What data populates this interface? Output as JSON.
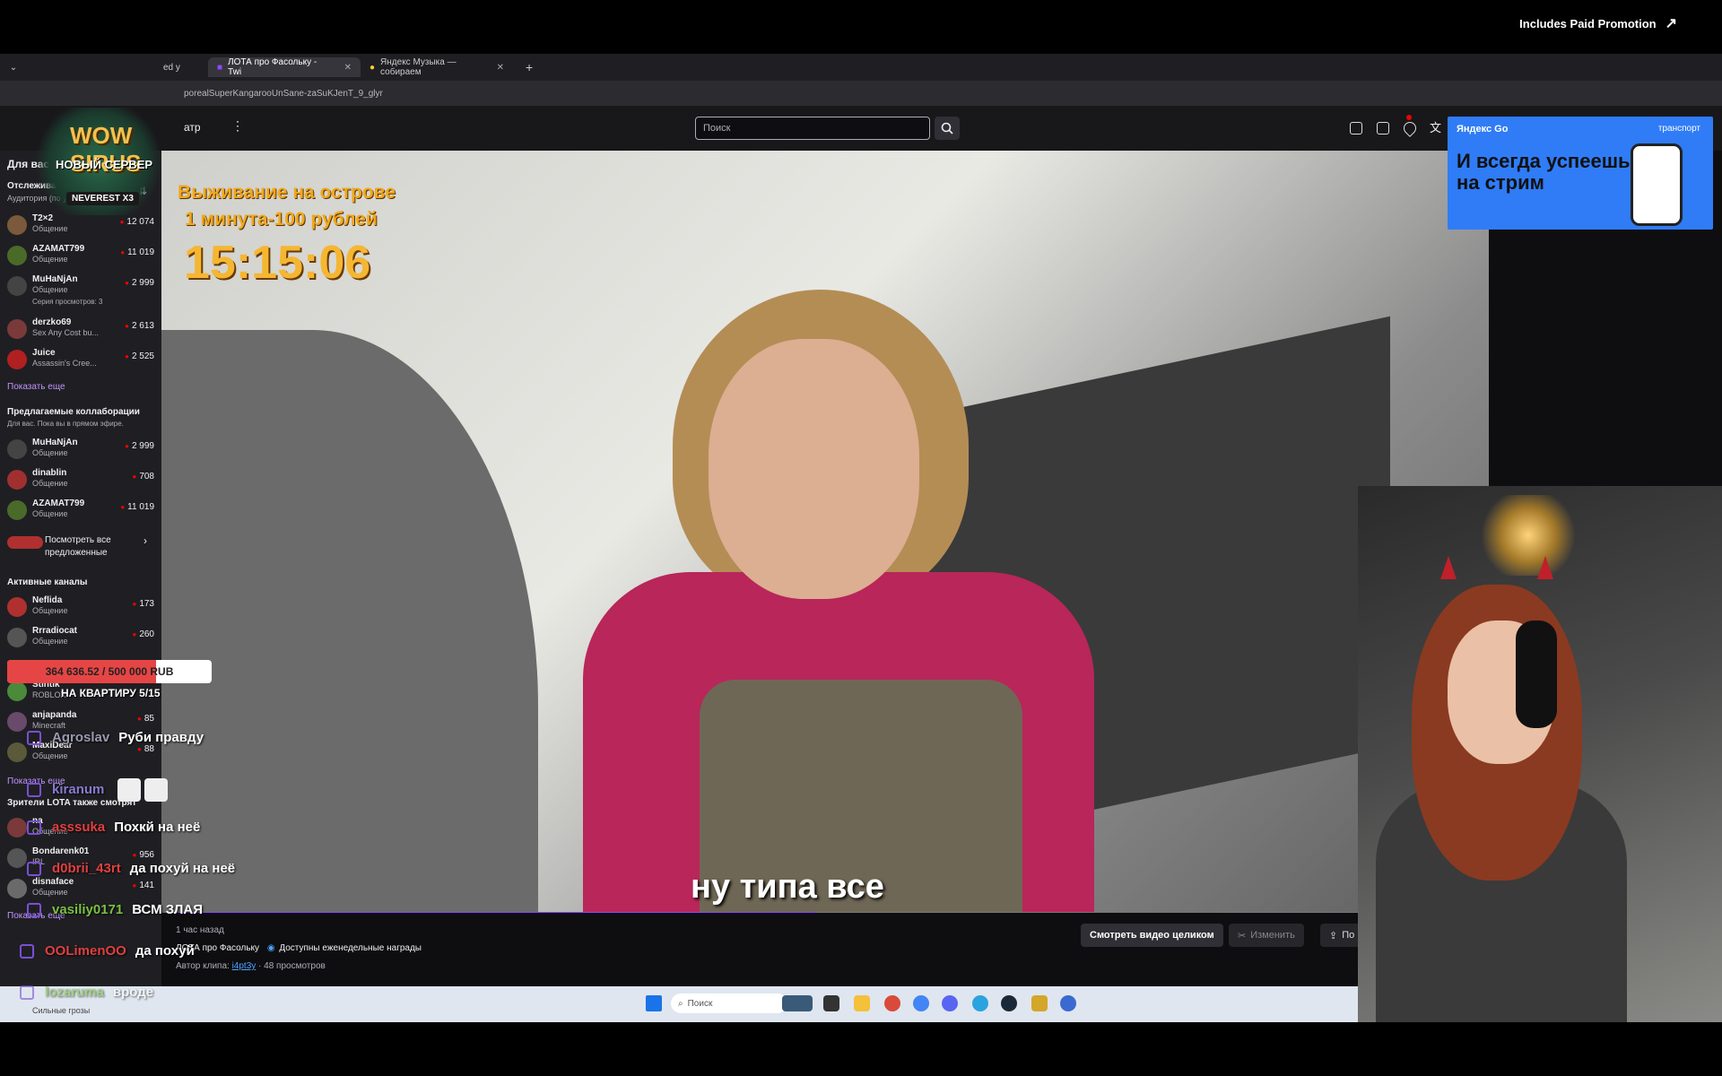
{
  "player": {
    "paid_promo": "Includes Paid Promotion"
  },
  "browser": {
    "tabs": [
      {
        "label": "ed y"
      },
      {
        "label": "ЛОТА про Фасольку - Twi"
      },
      {
        "label": "Яндекс Музыка — собираем"
      }
    ],
    "new_tab": "+",
    "url": "porealSuperKangarooUnSane-zaSuKJenT_9_glyr"
  },
  "twitch": {
    "nav_label": "атр",
    "search_placeholder": "Поиск"
  },
  "sidebar": {
    "for_you": "Для вас",
    "followed_header": "Отслеживаемые каналы",
    "followed_sub": "Аудитория (по убыв.)",
    "followed": [
      {
        "name": "T2×2",
        "game": "Общение",
        "viewers": "12 074",
        "color": "#7a5a3a"
      },
      {
        "name": "AZAMAT799",
        "game": "Общение",
        "viewers": "11 019",
        "color": "#4a6a2a"
      },
      {
        "name": "MuHaNjAn",
        "game": "Общение",
        "viewers": "2 999",
        "color": "#444"
      },
      {
        "name": "derzko69",
        "game": "Sex Any Cost bu...",
        "viewers": "2 613",
        "color": "#7a3a3a"
      },
      {
        "name": "Juice",
        "game": "Assassin's Cree...",
        "viewers": "2 525",
        "color": "#b02020"
      }
    ],
    "followed_extra": "Серия просмотров: 3",
    "show_more_1": "Показать еще",
    "collab_header": "Предлагаемые коллаборации",
    "collab_sub": "Для вас. Пока вы в прямом эфире.",
    "collab": [
      {
        "name": "MuHaNjAn",
        "game": "Общение",
        "viewers": "2 999",
        "color": "#444"
      },
      {
        "name": "dinablin",
        "game": "Общение",
        "viewers": "708",
        "color": "#a03030"
      },
      {
        "name": "AZAMAT799",
        "game": "Общение",
        "viewers": "11 019",
        "color": "#4a6a2a"
      }
    ],
    "see_all": "Посмотреть все предложенные",
    "active_header": "Активные каналы",
    "active": [
      {
        "name": "Neflida",
        "game": "Общение",
        "viewers": "173",
        "color": "#b03030"
      },
      {
        "name": "Rrradiocat",
        "game": "Общение",
        "viewers": "260",
        "color": "#555"
      },
      {
        "name": "Stintik",
        "game": "ROBLOX",
        "viewers": "",
        "color": "#4a8a3a"
      },
      {
        "name": "anjapanda",
        "game": "Minecraft",
        "viewers": "85",
        "color": "#6a4a6a"
      },
      {
        "name": "MaxiDear",
        "game": "Общение",
        "viewers": "88",
        "color": "#5a5a3a"
      }
    ],
    "show_more_2": "Показать еще",
    "also_watch": "Зрители LOTA также смотрят",
    "also": [
      {
        "name": "na",
        "game": "Общение",
        "viewers": "",
        "color": "#7a3a3a"
      },
      {
        "name": "Bondarenk01",
        "game": "IRL",
        "viewers": "956",
        "color": "#555"
      },
      {
        "name": "disnaface",
        "game": "Общение",
        "viewers": "141",
        "color": "#6a6a6a"
      }
    ],
    "show_more_3": "Показать еще"
  },
  "overlay": {
    "title_line1": "Выживание на острове",
    "title_line2": "1 минута-100 рублей",
    "timer": "15:15:06",
    "subtitle": "ну типа все"
  },
  "donation": {
    "text": "364 636.52 / 500 000 RUB",
    "label": "НА КВАРТИРУ 5/15",
    "progress": 0.729
  },
  "clip_info": {
    "time_ago": "1 час назад",
    "channel": "ЛОТА про Фасольку",
    "rewards": "Доступны еженедельные награды",
    "author_prefix": "Автор клипа:",
    "author": "i4pt3y",
    "views": "· 48 просмотров",
    "watch_full": "Смотреть видео целиком",
    "edit": "Изменить",
    "share": "По"
  },
  "taskbar": {
    "search": "Поиск",
    "weather": "Сильные грозы"
  },
  "ad": {
    "brand": "Яндекс Go",
    "transport": "транспорт",
    "headline_1": "И всегда успеешь",
    "headline_2": "на стрим"
  },
  "wow_logo": {
    "line1": "WOW SIRUS",
    "line2": "НОВЫЙ СЕРВЕР",
    "line3": "NEVEREST X3"
  },
  "chat": [
    {
      "user": "Agroslav",
      "msg": "Руби правду",
      "color": "#9a9ab0"
    },
    {
      "user": "kiranum",
      "msg": "",
      "color": "#8a7ad0"
    },
    {
      "user": "asssuka",
      "msg": "Похкй на неё",
      "color": "#e04040"
    },
    {
      "user": "d0brii_43rt",
      "msg": "да похуй на неё",
      "color": "#e04040"
    },
    {
      "user": "vasiliy0171",
      "msg": "ВСМ ЗЛАЯ",
      "color": "#7ac040"
    },
    {
      "user": "OOLimenOO",
      "msg": "да похуй",
      "color": "#e04040"
    },
    {
      "user": "lozaruma",
      "msg": "вроде",
      "color": "#7ac040"
    }
  ]
}
